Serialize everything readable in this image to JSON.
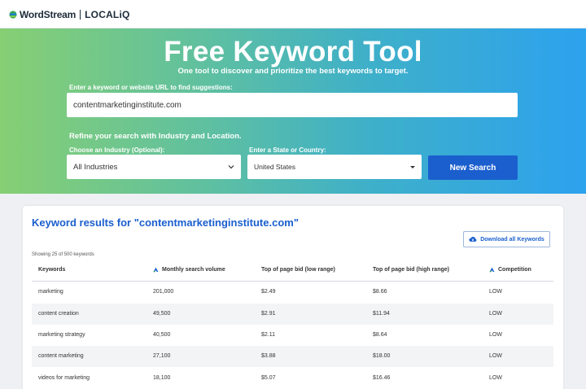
{
  "brand": {
    "wordstream": "WordStream",
    "localiq": "LOCALiQ",
    "logo_icon": "wordstream-logo-icon"
  },
  "hero": {
    "title": "Free Keyword Tool",
    "subtitle": "One tool to discover and prioritize the best keywords to target.",
    "url_label": "Enter a keyword or website URL to find suggestions:",
    "url_value": "contentmarketinginstitute.com",
    "refine_label": "Refine your search with Industry and Location.",
    "industry_label": "Choose an Industry (Optional):",
    "industry_value": "All Industries",
    "location_label": "Enter a State or Country:",
    "location_value": "United States",
    "search_button": "New Search"
  },
  "results": {
    "title": "Keyword results for \"contentmarketinginstitute.com\"",
    "download_label": "Download all Keywords",
    "showing": "Showing 25 of 500 keywords",
    "columns": [
      "Keywords",
      "Monthly search volume",
      "Top of page bid (low range)",
      "Top of page bid (high range)",
      "Competition"
    ],
    "rows": [
      {
        "keyword": "marketing",
        "volume": "201,000",
        "low": "$2.49",
        "high": "$8.66",
        "competition": "LOW"
      },
      {
        "keyword": "content creation",
        "volume": "49,500",
        "low": "$2.91",
        "high": "$11.94",
        "competition": "LOW"
      },
      {
        "keyword": "marketing strategy",
        "volume": "40,500",
        "low": "$2.11",
        "high": "$8.64",
        "competition": "LOW"
      },
      {
        "keyword": "content marketing",
        "volume": "27,100",
        "low": "$3.88",
        "high": "$18.00",
        "competition": "LOW"
      },
      {
        "keyword": "videos for marketing",
        "volume": "18,100",
        "low": "$5.07",
        "high": "$16.46",
        "competition": "LOW"
      }
    ]
  },
  "colors": {
    "accent": "#1b5fce",
    "gradient_start": "#86cf73",
    "gradient_end": "#2da2ee"
  }
}
